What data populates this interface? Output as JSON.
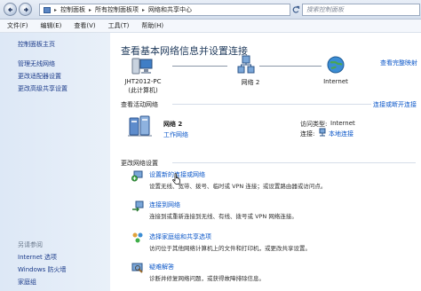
{
  "address_bar": {
    "path": [
      "控制面板",
      "所有控制面板项",
      "网络和共享中心"
    ],
    "search_placeholder": "搜索控制面板"
  },
  "menu": [
    "文件(F)",
    "编辑(E)",
    "查看(V)",
    "工具(T)",
    "帮助(H)"
  ],
  "sidebar": {
    "home": "控制面板主页",
    "links": [
      "管理无线网络",
      "更改适配器设置",
      "更改高级共享设置"
    ],
    "see_also_caption": "另请参阅",
    "see_also": [
      "Internet 选项",
      "Windows 防火墙",
      "家庭组"
    ]
  },
  "main": {
    "heading": "查看基本网络信息并设置连接",
    "view_full_map": "查看完整映射",
    "map": {
      "computer_name": "JHT2012-PC",
      "computer_sub": "(此计算机)",
      "network_name": "网络  2",
      "internet_label": "Internet"
    },
    "active_networks_title": "查看活动网络",
    "connect_disconnect": "连接或断开连接",
    "active_network": {
      "name": "网络  2",
      "type_link": "工作网络",
      "access_type_label": "访问类型:",
      "access_type_value": "Internet",
      "connections_label": "连接:",
      "connections_value": "本地连接"
    },
    "change_settings_title": "更改网络设置",
    "actions": [
      {
        "title": "设置新的连接或网络",
        "desc": "设置无线、宽带、拨号、临时或 VPN 连接；或设置路由器或访问点。"
      },
      {
        "title": "连接到网络",
        "desc": "连接到或重新连接到无线、有线、拨号或 VPN 网络连接。"
      },
      {
        "title": "选择家庭组和共享选项",
        "desc": "访问位于其他网络计算机上的文件和打印机，或更改共享设置。"
      },
      {
        "title": "疑难解答",
        "desc": "诊断并修复网络问题，或获得故障排除信息。"
      }
    ]
  },
  "colors": {
    "link": "#0a56c8",
    "heading": "#1e395b",
    "sidebar_bg": "#dde8f6"
  }
}
